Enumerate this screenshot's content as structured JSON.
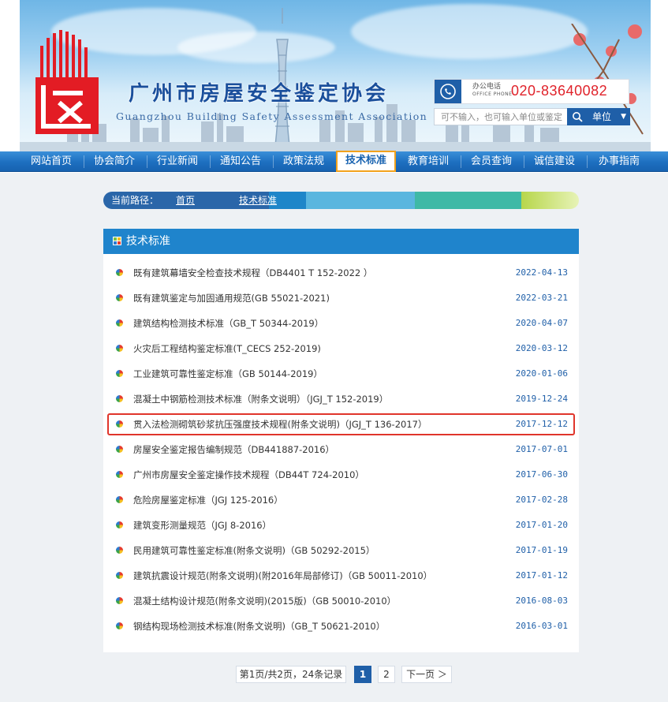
{
  "site": {
    "title_cn": "广州市房屋安全鉴定协会",
    "title_en": "Guangzhou Building Safety Assessment Association",
    "phone_label": "办公电话",
    "phone_label_en": "OFFICE PHONE",
    "phone": "020-83640082",
    "search_placeholder": "可不输入，也可输入单位或鉴定",
    "search_scope": "单位"
  },
  "nav": {
    "items": [
      {
        "label": "网站首页"
      },
      {
        "label": "协会简介"
      },
      {
        "label": "行业新闻"
      },
      {
        "label": "通知公告"
      },
      {
        "label": "政策法规"
      },
      {
        "label": "技术标准"
      },
      {
        "label": "教育培训"
      },
      {
        "label": "会员查询"
      },
      {
        "label": "诚信建设"
      },
      {
        "label": "办事指南"
      }
    ],
    "active": "技术标准"
  },
  "breadcrumb": {
    "label": "当前路径：",
    "links": [
      "首页",
      "技术标准"
    ]
  },
  "panel": {
    "title": "技术标准"
  },
  "articles": [
    {
      "title": "既有建筑幕墙安全检查技术规程（DB4401 T 152-2022 ）",
      "date": "2022-04-13"
    },
    {
      "title": "既有建筑鉴定与加固通用规范(GB 55021-2021)",
      "date": "2022-03-21"
    },
    {
      "title": "建筑结构检测技术标准（GB_T 50344-2019）",
      "date": "2020-04-07"
    },
    {
      "title": "火灾后工程结构鉴定标准(T_CECS 252-2019)",
      "date": "2020-03-12"
    },
    {
      "title": "工业建筑可靠性鉴定标准（GB 50144-2019）",
      "date": "2020-01-06"
    },
    {
      "title": "混凝土中钢筋检测技术标准（附条文说明）（JGJ_T 152-2019）",
      "date": "2019-12-24"
    },
    {
      "title": "贯入法检测砌筑砂浆抗压强度技术规程(附条文说明)（JGJ_T 136-2017）",
      "date": "2017-12-12"
    },
    {
      "title": "房屋安全鉴定报告编制规范（DB441887-2016）",
      "date": "2017-07-01"
    },
    {
      "title": "广州市房屋安全鉴定操作技术规程（DB44T 724-2010）",
      "date": "2017-06-30"
    },
    {
      "title": "危险房屋鉴定标准（JGJ 125-2016）",
      "date": "2017-02-28"
    },
    {
      "title": "建筑变形测量规范（JGJ 8-2016）",
      "date": "2017-01-20"
    },
    {
      "title": "民用建筑可靠性鉴定标准(附条文说明)（GB 50292-2015）",
      "date": "2017-01-19"
    },
    {
      "title": "建筑抗震设计规范(附条文说明)(附2016年局部修订)（GB 50011-2010）",
      "date": "2017-01-12"
    },
    {
      "title": "混凝土结构设计规范(附条文说明)(2015版)（GB 50010-2010）",
      "date": "2016-08-03"
    },
    {
      "title": "钢结构现场检测技术标准(附条文说明)（GB_T 50621-2010）",
      "date": "2016-03-01"
    }
  ],
  "highlighted_index": 6,
  "pagination": {
    "summary": "第1页/共2页，24条记录",
    "pages": [
      "1",
      "2"
    ],
    "current": "1",
    "next": "下一页 ＞"
  },
  "colors": {
    "nav": "#1d6fc0",
    "panel_head": "#1f84cc",
    "date": "#1f5fa8",
    "highlight": "#e0352b",
    "phone": "#e0222a"
  }
}
